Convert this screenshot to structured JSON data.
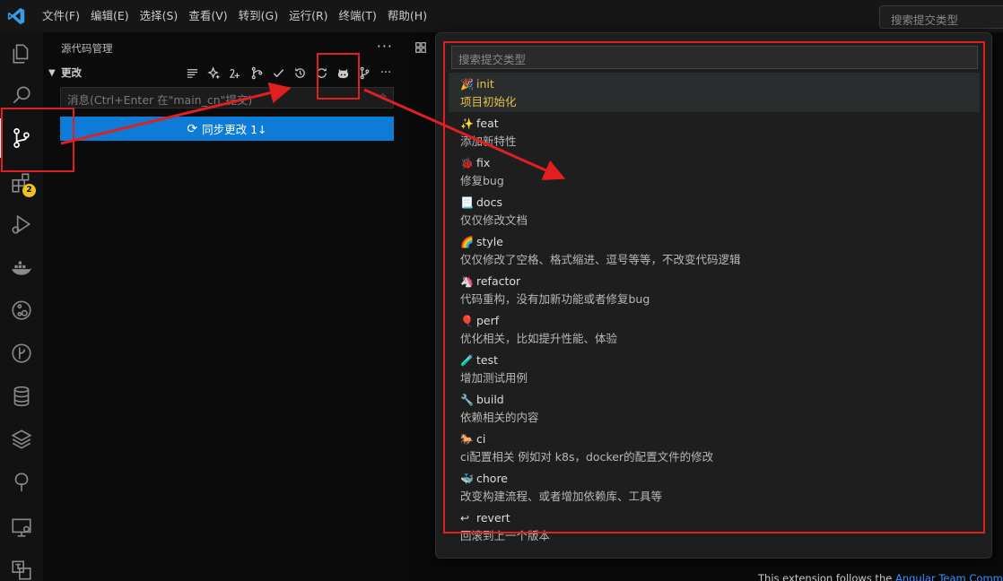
{
  "menu": [
    "文件(F)",
    "编辑(E)",
    "选择(S)",
    "查看(V)",
    "转到(G)",
    "运行(R)",
    "终端(T)",
    "帮助(H)"
  ],
  "title_search_placeholder": "搜索提交类型",
  "sidebar": {
    "title": "源代码管理",
    "changes_label": "更改",
    "message_placeholder": "消息(Ctrl+Enter 在\"main_cn\"提交)",
    "sync_button": "同步更改 1↓"
  },
  "activity_badge": "2",
  "quickpick": {
    "placeholder": "搜索提交类型",
    "items": [
      {
        "emoji": "🎉",
        "label": "init",
        "desc": "项目初始化"
      },
      {
        "emoji": "✨",
        "label": "feat",
        "desc": "添加新特性"
      },
      {
        "emoji": "🐞",
        "label": "fix",
        "desc": "修复bug"
      },
      {
        "emoji": "📃",
        "label": "docs",
        "desc": "仅仅修改文档"
      },
      {
        "emoji": "🌈",
        "label": "style",
        "desc": "仅仅修改了空格、格式缩进、逗号等等，不改变代码逻辑"
      },
      {
        "emoji": "🦄",
        "label": "refactor",
        "desc": "代码重构，没有加新功能或者修复bug"
      },
      {
        "emoji": "🎈",
        "label": "perf",
        "desc": "优化相关，比如提升性能、体验"
      },
      {
        "emoji": "🧪",
        "label": "test",
        "desc": "增加测试用例"
      },
      {
        "emoji": "🔧",
        "label": "build",
        "desc": "依赖相关的内容"
      },
      {
        "emoji": "🐎",
        "label": "ci",
        "desc": "ci配置相关 例如对 k8s，docker的配置文件的修改"
      },
      {
        "emoji": "🐳",
        "label": "chore",
        "desc": "改变构建流程、或者增加依赖库、工具等"
      },
      {
        "emoji": "↩",
        "label": "revert",
        "desc": "回滚到上一个版本"
      }
    ]
  },
  "editor_note": {
    "prefix": "This extension follows the ",
    "link": "Angular Team Comm"
  },
  "colors": {
    "accent": "#0e7cd6",
    "highlight": "#e02020",
    "selected_text": "#e8c34a"
  }
}
